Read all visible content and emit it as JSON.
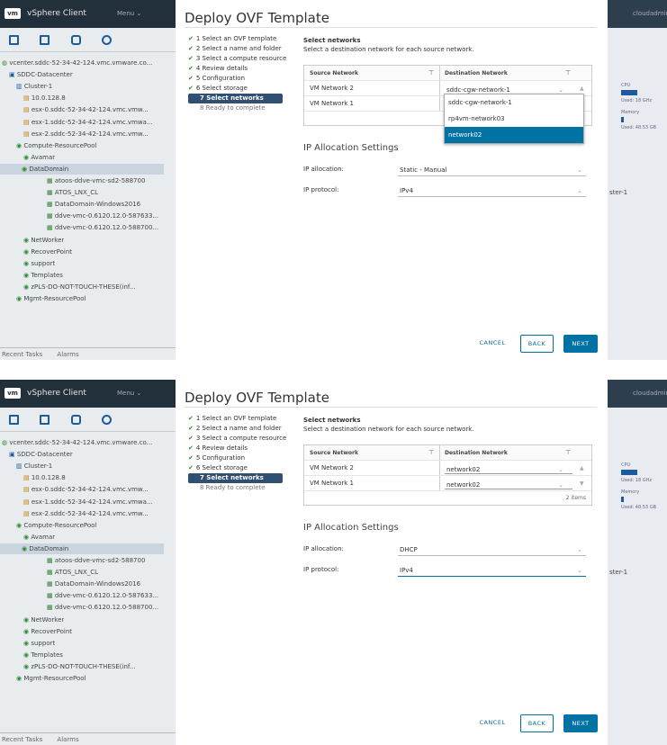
{
  "app": {
    "logo": "vm",
    "title": "vSphere Client",
    "menu": "Menu",
    "user": "cloudadmin"
  },
  "sidebar": {
    "tree": [
      "vcenter.sddc-52-34-42-124.vmc.vmware.co...",
      "SDDC-Datacenter",
      "Cluster-1",
      "10.0.128.8",
      "esx-0.sddc-52-34-42-124.vmc.vmw...",
      "esx-1.sddc-52-34-42-124.vmc.vmwa...",
      "esx-2.sddc-52-34-42-124.vmc.vmw...",
      "Compute-ResourcePool",
      "Avamar",
      "DataDomain",
      "atoos-ddve-vmc-sd2-588700",
      "ATOS_LNX_CL",
      "DataDomain-Windows2016",
      "ddve-vmc-0.6120.12.0-587633...",
      "ddve-vmc-0.6120.12.0-588700...",
      "NetWorker",
      "RecoverPoint",
      "support",
      "Templates",
      "zPLS-DO-NOT-TOUCH-THESE(inf...",
      "Mgmt-ResourcePool"
    ],
    "recent_tasks": "Recent Tasks",
    "alarms": "Alarms"
  },
  "right": {
    "cpu": "CPU",
    "cpu_used": "Used: 18 GHz",
    "memory": "Memory",
    "mem_used": "Used: 48.53 GB",
    "cluster": "ster-1"
  },
  "wizard": {
    "title": "Deploy OVF Template",
    "steps_done": [
      "1 Select an OVF template",
      "2 Select a name and folder",
      "3 Select a compute resource",
      "4 Review details",
      "5 Configuration",
      "6 Select storage"
    ],
    "step_current": "7 Select networks",
    "step_pending": "8 Ready to complete",
    "section_title": "Select networks",
    "section_sub": "Select a destination network for each source network.",
    "col_source": "Source Network",
    "col_dest": "Destination Network",
    "ip_heading": "IP Allocation Settings",
    "ip_alloc_label": "IP allocation:",
    "ip_proto_label": "IP protocol:",
    "cancel": "CANCEL",
    "back": "BACK",
    "next": "NEXT"
  },
  "p1": {
    "rows": [
      {
        "source": "VM Network 2",
        "dest": "sddc-cgw-network-1"
      },
      {
        "source": "VM Network 1",
        "dest": ""
      }
    ],
    "dropdown": [
      "sddc-cgw-network-1",
      "rp4vm-network03",
      "network02"
    ],
    "ip_alloc": "Static - Manual",
    "ip_proto": "IPv4"
  },
  "p2": {
    "rows": [
      {
        "source": "VM Network 2",
        "dest": "network02"
      },
      {
        "source": "VM Network 1",
        "dest": "network02"
      }
    ],
    "items": "2 items",
    "ip_alloc": "DHCP",
    "ip_proto": "IPv4"
  }
}
